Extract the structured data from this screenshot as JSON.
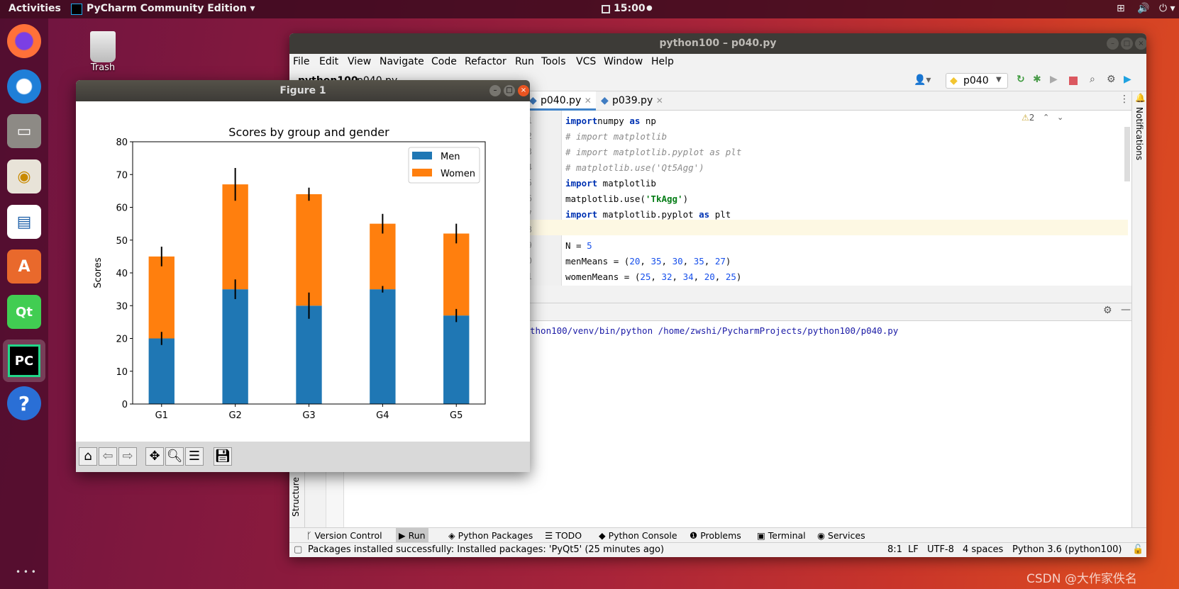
{
  "topbar": {
    "activities": "Activities",
    "app_name": "PyCharm Community Edition",
    "clock": "15:00"
  },
  "desktop": {
    "trash_label": "Trash",
    "watermark": "CSDN @大作家佚名"
  },
  "dock": {
    "items": [
      "firefox",
      "thunderbird",
      "files",
      "rhythmbox",
      "libreoffice-impress",
      "ubuntu-software",
      "qt-creator",
      "pycharm",
      "help"
    ]
  },
  "pycharm": {
    "title": "python100 – p040.py",
    "menu": [
      "File",
      "Edit",
      "View",
      "Navigate",
      "Code",
      "Refactor",
      "Run",
      "Tools",
      "VCS",
      "Window",
      "Help"
    ],
    "breadcrumb": [
      "python100",
      "p040.py"
    ],
    "run_config": "p040",
    "tabs": [
      {
        "label": "p040.py",
        "active": true
      },
      {
        "label": "p039.py",
        "active": false
      }
    ],
    "inspection_count": "2",
    "code": [
      {
        "n": "1",
        "parts": [
          [
            "kw",
            "import"
          ],
          [
            "",
            "numpy "
          ],
          [
            "kw",
            "as"
          ],
          [
            "",
            " np"
          ]
        ]
      },
      {
        "n": "2",
        "parts": [
          [
            "cm",
            "# import matplotlib"
          ]
        ]
      },
      {
        "n": "3",
        "parts": [
          [
            "cm",
            "# import matplotlib.pyplot as plt"
          ]
        ]
      },
      {
        "n": "4",
        "parts": [
          [
            "cm",
            "# matplotlib.use('Qt5Agg')"
          ]
        ]
      },
      {
        "n": "5",
        "parts": [
          [
            "kw",
            "import"
          ],
          [
            "",
            " matplotlib"
          ]
        ]
      },
      {
        "n": "6",
        "parts": [
          [
            "",
            "matplotlib.use("
          ],
          [
            "str",
            "'TkAgg'"
          ],
          [
            "",
            ")"
          ]
        ]
      },
      {
        "n": "7",
        "parts": [
          [
            "kw",
            "import"
          ],
          [
            "",
            " matplotlib.pyplot "
          ],
          [
            "kw",
            "as"
          ],
          [
            "",
            " plt"
          ]
        ]
      },
      {
        "n": "8",
        "parts": []
      },
      {
        "n": "9",
        "parts": [
          [
            "",
            "N = "
          ],
          [
            "num",
            "5"
          ]
        ]
      },
      {
        "n": "10",
        "parts": [
          [
            "",
            "menMeans = ("
          ],
          [
            "num",
            "20"
          ],
          [
            "",
            ", "
          ],
          [
            "num",
            "35"
          ],
          [
            "",
            ", "
          ],
          [
            "num",
            "30"
          ],
          [
            "",
            ", "
          ],
          [
            "num",
            "35"
          ],
          [
            "",
            ", "
          ],
          [
            "num",
            "27"
          ],
          [
            "",
            ")"
          ]
        ]
      },
      {
        "n": "11",
        "parts": [
          [
            "",
            "womenMeans = ("
          ],
          [
            "num",
            "25"
          ],
          [
            "",
            ", "
          ],
          [
            "num",
            "32"
          ],
          [
            "",
            ", "
          ],
          [
            "num",
            "34"
          ],
          [
            "",
            ", "
          ],
          [
            "num",
            "20"
          ],
          [
            "",
            ", "
          ],
          [
            "num",
            "25"
          ],
          [
            "",
            ")"
          ]
        ]
      }
    ],
    "console_text": "thon100/venv/bin/python /home/zwshi/PycharmProjects/python100/p040.py",
    "left_strip_label": "Structure",
    "right_strip_label": "Notifications",
    "bottom_tools": [
      "Version Control",
      "Run",
      "Python Packages",
      "TODO",
      "Python Console",
      "Problems",
      "Terminal",
      "Services"
    ],
    "status": {
      "message": "Packages installed successfully: Installed packages: 'PyQt5' (25 minutes ago)",
      "position": "8:1",
      "line_sep": "LF",
      "encoding": "UTF-8",
      "indent": "4 spaces",
      "interpreter": "Python 3.6 (python100)"
    }
  },
  "figure": {
    "title": "Figure 1",
    "toolbar": [
      "home",
      "back",
      "forward",
      "pan",
      "zoom",
      "configure",
      "save"
    ]
  },
  "chart_data": {
    "type": "bar",
    "stacked": true,
    "title": "Scores by group and gender",
    "xlabel": "",
    "ylabel": "Scores",
    "categories": [
      "G1",
      "G2",
      "G3",
      "G4",
      "G5"
    ],
    "ylim": [
      0,
      80
    ],
    "yticks": [
      0,
      10,
      20,
      30,
      40,
      50,
      60,
      70,
      80
    ],
    "legend": "top-right",
    "grid": false,
    "series": [
      {
        "name": "Men",
        "values": [
          20,
          35,
          30,
          35,
          27
        ],
        "errors": [
          2,
          3,
          4,
          1,
          2
        ],
        "color": "#1f77b4"
      },
      {
        "name": "Women",
        "values": [
          25,
          32,
          34,
          20,
          25
        ],
        "errors": [
          3,
          5,
          2,
          3,
          3
        ],
        "color": "#ff7f0e"
      }
    ]
  }
}
